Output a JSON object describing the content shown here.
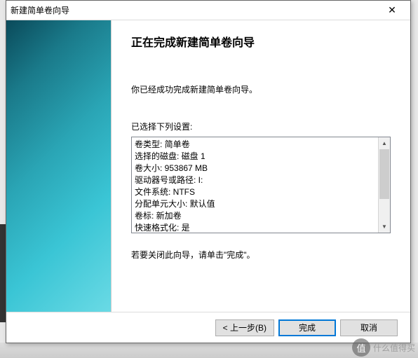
{
  "window": {
    "title": "新建简单卷向导"
  },
  "heading": "正在完成新建简单卷向导",
  "intro": "你已经成功完成新建简单卷向导。",
  "settings_label": "已选择下列设置:",
  "settings": {
    "volume_type": "卷类型: 简单卷",
    "selected_disk": "选择的磁盘: 磁盘 1",
    "volume_size": "卷大小: 953867 MB",
    "drive_letter": "驱动器号或路径: I:",
    "file_system": "文件系统: NTFS",
    "allocation_unit": "分配单元大小: 默认值",
    "volume_label": "卷标: 新加卷",
    "quick_format": "快速格式化: 是"
  },
  "close_hint": "若要关闭此向导，请单击\"完成\"。",
  "buttons": {
    "back": "< 上一步(B)",
    "finish": "完成",
    "cancel": "取消"
  },
  "watermark": {
    "badge": "值",
    "text": "什么值得买"
  }
}
